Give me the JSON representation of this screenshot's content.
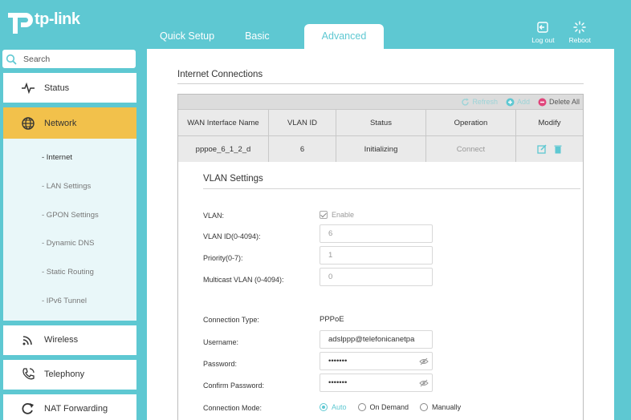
{
  "brand": {
    "name": "tp-link"
  },
  "tabs": [
    {
      "label": "Quick Setup"
    },
    {
      "label": "Basic"
    },
    {
      "label": "Advanced"
    }
  ],
  "header_actions": {
    "logout": "Log out",
    "reboot": "Reboot"
  },
  "search": {
    "placeholder": "Search"
  },
  "sidebar": {
    "items": [
      {
        "label": "Status",
        "icon": "pulse-icon"
      },
      {
        "label": "Network",
        "icon": "globe-icon"
      },
      {
        "label": "Wireless",
        "icon": "wifi-icon"
      },
      {
        "label": "Telephony",
        "icon": "phone-icon"
      },
      {
        "label": "NAT Forwarding",
        "icon": "nat-icon"
      }
    ],
    "network_sub": [
      {
        "label": "- Internet"
      },
      {
        "label": "- LAN Settings"
      },
      {
        "label": "- GPON Settings"
      },
      {
        "label": "- Dynamic DNS"
      },
      {
        "label": "- Static Routing"
      },
      {
        "label": "- IPv6 Tunnel"
      }
    ]
  },
  "main": {
    "title": "Internet Connections",
    "toolbar": {
      "refresh": "Refresh",
      "add": "Add",
      "delete_all": "Delete All"
    },
    "columns": [
      "WAN Interface Name",
      "VLAN ID",
      "Status",
      "Operation",
      "Modify"
    ],
    "row": {
      "name": "pppoe_6_1_2_d",
      "vlan_id": "6",
      "status": "Initializing",
      "operation": "Connect"
    },
    "vlan_settings": {
      "title": "VLAN Settings",
      "vlan_label": "VLAN:",
      "enable_label": "Enable",
      "vlan_id_label": "VLAN ID(0-4094):",
      "vlan_id_value": "6",
      "priority_label": "Priority(0-7):",
      "priority_value": "1",
      "multicast_label": "Multicast VLAN (0-4094):",
      "multicast_value": "0"
    },
    "connection": {
      "type_label": "Connection Type:",
      "type_value": "PPPoE",
      "username_label": "Username:",
      "username_value": "adslppp@telefonicanetpa",
      "password_label": "Password:",
      "password_value": "•••••••",
      "confirm_label": "Confirm Password:",
      "confirm_value": "•••••••",
      "mode_label": "Connection Mode:",
      "modes": [
        "Auto",
        "On Demand",
        "Manually"
      ],
      "selected_mode": "Auto"
    }
  },
  "colors": {
    "accent": "#5ec8d2",
    "active_nav": "#f2c14b"
  }
}
